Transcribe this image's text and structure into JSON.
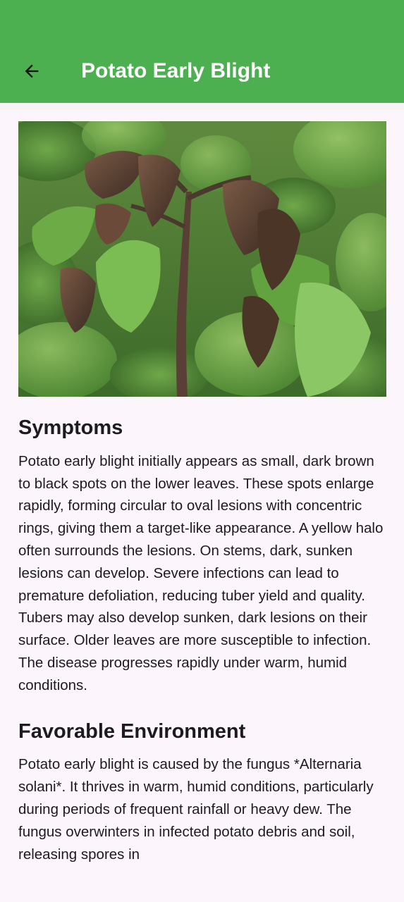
{
  "header": {
    "title": "Potato Early Blight",
    "back_icon": "arrow-left-icon",
    "background": "#4caf50"
  },
  "hero": {
    "icon": "potato-plant-photo"
  },
  "sections": [
    {
      "heading": "Symptoms",
      "body": "Potato early blight initially appears as small, dark brown to black spots on the lower leaves. These spots enlarge rapidly, forming circular to oval lesions with concentric rings, giving them a target-like appearance. A yellow halo often surrounds the lesions. On stems, dark, sunken lesions can develop. Severe infections can lead to premature defoliation, reducing tuber yield and quality. Tubers may also develop sunken, dark lesions on their surface. Older leaves are more susceptible to infection. The disease progresses rapidly under warm, humid conditions."
    },
    {
      "heading": "Favorable Environment",
      "body": "Potato early blight is caused by the fungus *Alternaria solani*. It thrives in warm, humid conditions, particularly during periods of frequent rainfall or heavy dew. The fungus overwinters in infected potato debris and soil, releasing spores in"
    }
  ]
}
